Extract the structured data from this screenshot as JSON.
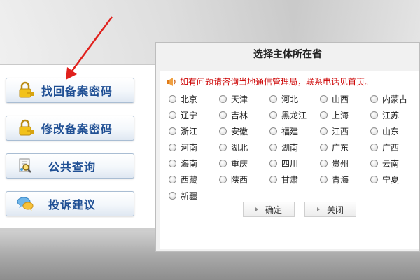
{
  "left_panel": {
    "buttons": [
      {
        "label": "找回备案密码",
        "icon": "lock-key-icon"
      },
      {
        "label": "修改备案密码",
        "icon": "lock-key-icon"
      },
      {
        "label": "公共查询",
        "icon": "document-search-icon"
      },
      {
        "label": "投诉建议",
        "icon": "chat-bubbles-icon"
      }
    ]
  },
  "dialog": {
    "title": "选择主体所在省",
    "notice": "如有问题请咨询当地通信管理局，联系电话见首页。",
    "provinces": [
      "北京",
      "天津",
      "河北",
      "山西",
      "内蒙古",
      "辽宁",
      "吉林",
      "黑龙江",
      "上海",
      "江苏",
      "浙江",
      "安徽",
      "福建",
      "江西",
      "山东",
      "河南",
      "湖北",
      "湖南",
      "广东",
      "广西",
      "海南",
      "重庆",
      "四川",
      "贵州",
      "云南",
      "西藏",
      "陕西",
      "甘肃",
      "青海",
      "宁夏",
      "新疆"
    ],
    "confirm_label": "确定",
    "close_label": "关闭"
  },
  "colors": {
    "button_text": "#1f4f94",
    "notice_text": "#cc0000",
    "arrow": "#e0201c"
  }
}
